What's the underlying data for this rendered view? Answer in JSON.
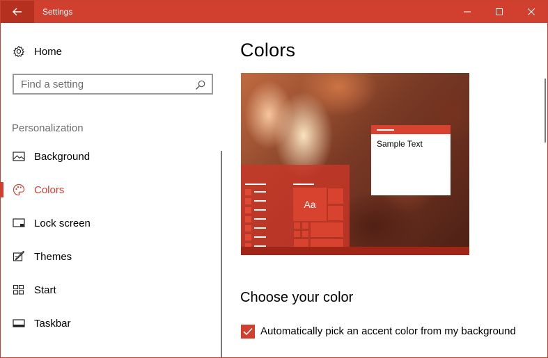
{
  "window": {
    "title": "Settings",
    "accent_color": "#d13f2f",
    "controls": {
      "minimize_icon": "minimize-icon",
      "maximize_icon": "maximize-icon",
      "close_icon": "close-icon"
    }
  },
  "sidebar": {
    "home": {
      "label": "Home",
      "icon": "gear-icon"
    },
    "search": {
      "placeholder": "Find a setting",
      "icon": "search-icon"
    },
    "section_label": "Personalization",
    "items": [
      {
        "label": "Background",
        "icon": "picture-icon",
        "active": false
      },
      {
        "label": "Colors",
        "icon": "palette-icon",
        "active": true
      },
      {
        "label": "Lock screen",
        "icon": "lock-screen-icon",
        "active": false
      },
      {
        "label": "Themes",
        "icon": "themes-icon",
        "active": false
      },
      {
        "label": "Start",
        "icon": "start-icon",
        "active": false
      },
      {
        "label": "Taskbar",
        "icon": "taskbar-icon",
        "active": false
      }
    ]
  },
  "main": {
    "title": "Colors",
    "preview": {
      "sample_text": "Sample Text",
      "tile_label": "Aa"
    },
    "choose_color_heading": "Choose your color",
    "auto_accent": {
      "label": "Automatically pick an accent color from my background",
      "checked": true
    }
  }
}
